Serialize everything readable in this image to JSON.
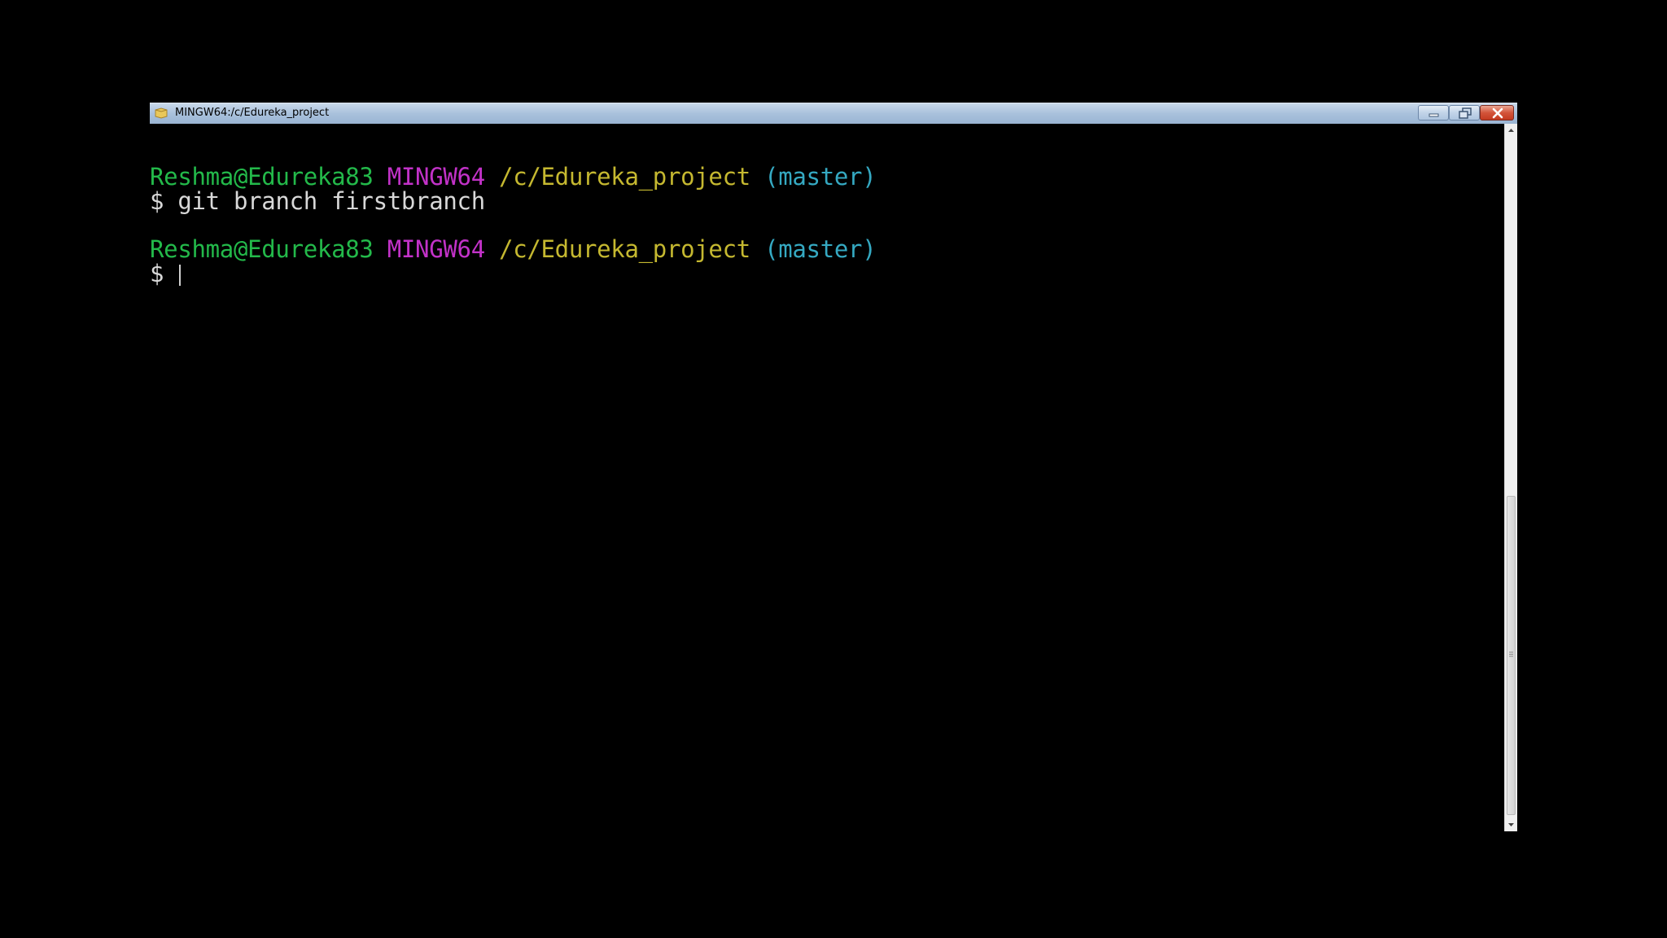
{
  "window": {
    "title": "MINGW64:/c/Edureka_project"
  },
  "terminal": {
    "lines": [
      {
        "user_host": "Reshma@Edureka83",
        "shell": "MINGW64",
        "path": "/c/Edureka_project",
        "branch": "(master)"
      },
      {
        "prompt": "$",
        "command": "git branch firstbranch"
      },
      {
        "user_host": "Reshma@Edureka83",
        "shell": "MINGW64",
        "path": "/c/Edureka_project",
        "branch": "(master)"
      },
      {
        "prompt": "$",
        "command": ""
      }
    ]
  },
  "colors": {
    "user_host": "#23b94a",
    "shell": "#c232c8",
    "path": "#c5b830",
    "branch": "#35a9c2",
    "command": "#d8d8d8",
    "background": "#000000"
  },
  "icons": {
    "app": "mingw-terminal-icon",
    "minimize": "minimize-icon",
    "maximize": "restore-icon",
    "close": "close-icon"
  }
}
